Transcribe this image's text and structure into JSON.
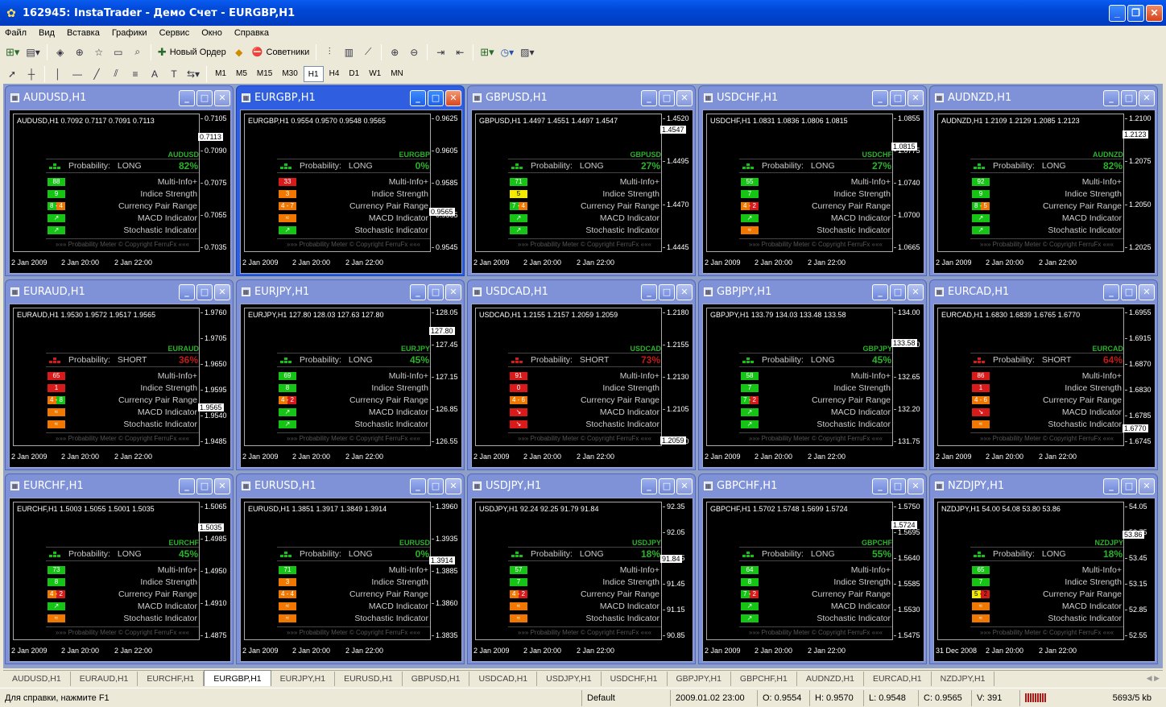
{
  "window": {
    "title": "162945: InstaTrader - Демо Счет - EURGBP,H1"
  },
  "menu": [
    "Файл",
    "Вид",
    "Вставка",
    "Графики",
    "Сервис",
    "Окно",
    "Справка"
  ],
  "toolbar": {
    "new_order": "Новый Ордер",
    "experts": "Советники"
  },
  "timeframes": [
    "M1",
    "M5",
    "M15",
    "M30",
    "H1",
    "H4",
    "D1",
    "W1",
    "MN"
  ],
  "active_timeframe": "H1",
  "panel": {
    "probability_label": "Probability:",
    "indicators": [
      "Multi-Info+",
      "Indice Strength",
      "Currency Pair Range",
      "MACD Indicator",
      "Stochastic Indicator"
    ],
    "copyright": "»»» Probability Meter © Copyright FerruFx «««"
  },
  "colors": {
    "green": "#16c416",
    "red": "#d81a1a",
    "orange": "#f07800",
    "yellow": "#f2ea00",
    "up_text": "#2bb32b",
    "down_text": "#c31a1a"
  },
  "charts": [
    {
      "title": "AUDUSD,H1",
      "ohlc": "AUDUSD,H1  0.7092 0.7117 0.7091 0.7113",
      "symbol": "AUDUSD",
      "dir": "LONG",
      "pct": "82%",
      "color": "green",
      "ind": [
        {
          "t": "88",
          "c": "green"
        },
        {
          "t": "9",
          "c": "green"
        },
        {
          "t": "8 - 4",
          "c": "green",
          "c2": "orange"
        },
        {
          "t": "↗",
          "c": "green"
        },
        {
          "t": "↗",
          "c": "green"
        }
      ],
      "prices": [
        "0.7105",
        "0.7090",
        "0.7075",
        "0.7055",
        "0.7035"
      ],
      "current": "0.7113",
      "cur_y": 0.17,
      "times": [
        "2 Jan 2009",
        "2 Jan 20:00",
        "2 Jan 22:00"
      ]
    },
    {
      "title": "EURGBP,H1",
      "ohlc": "EURGBP,H1  0.9554 0.9570 0.9548 0.9565",
      "symbol": "EURGBP",
      "dir": "LONG",
      "pct": "0%",
      "color": "green",
      "ind": [
        {
          "t": "33",
          "c": "red"
        },
        {
          "t": "3",
          "c": "orange"
        },
        {
          "t": "4 - 7",
          "c": "orange",
          "c2": "orange"
        },
        {
          "t": "≈",
          "c": "orange"
        },
        {
          "t": "↗",
          "c": "green"
        }
      ],
      "prices": [
        "0.9625",
        "0.9605",
        "0.9585",
        "0.9565",
        "0.9545"
      ],
      "current": "0.9565",
      "cur_y": 0.72,
      "times": [
        "2 Jan 2009",
        "2 Jan 20:00",
        "2 Jan 22:00"
      ]
    },
    {
      "title": "GBPUSD,H1",
      "ohlc": "GBPUSD,H1  1.4497 1.4551 1.4497 1.4547",
      "symbol": "GBPUSD",
      "dir": "LONG",
      "pct": "27%",
      "color": "green",
      "ind": [
        {
          "t": "71",
          "c": "green"
        },
        {
          "t": "5",
          "c": "yellow"
        },
        {
          "t": "7 - 4",
          "c": "green",
          "c2": "orange"
        },
        {
          "t": "↗",
          "c": "green"
        },
        {
          "t": "↗",
          "c": "green"
        }
      ],
      "prices": [
        "1.4520",
        "1.4495",
        "1.4470",
        "1.4445"
      ],
      "current": "1.4547",
      "cur_y": 0.12,
      "times": [
        "2 Jan 2009",
        "2 Jan 20:00",
        "2 Jan 22:00"
      ]
    },
    {
      "title": "USDCHF,H1",
      "ohlc": "USDCHF,H1  1.0831 1.0836 1.0806 1.0815",
      "symbol": "USDCHF",
      "dir": "LONG",
      "pct": "27%",
      "color": "green",
      "ind": [
        {
          "t": "55",
          "c": "green"
        },
        {
          "t": "7",
          "c": "green"
        },
        {
          "t": "4 - 2",
          "c": "orange",
          "c2": "red"
        },
        {
          "t": "↗",
          "c": "green"
        },
        {
          "t": "≈",
          "c": "orange"
        }
      ],
      "prices": [
        "1.0855",
        "1.0775",
        "1.0740",
        "1.0700",
        "1.0665"
      ],
      "current": "1.0815",
      "cur_y": 0.24,
      "times": [
        "2 Jan 2009",
        "2 Jan 20:00",
        "2 Jan 22:00"
      ]
    },
    {
      "title": "AUDNZD,H1",
      "ohlc": "AUDNZD,H1  1.2109 1.2129 1.2085 1.2123",
      "symbol": "AUDNZD",
      "dir": "LONG",
      "pct": "82%",
      "color": "green",
      "ind": [
        {
          "t": "92",
          "c": "green"
        },
        {
          "t": "9",
          "c": "green"
        },
        {
          "t": "8 - 5",
          "c": "green",
          "c2": "orange"
        },
        {
          "t": "↗",
          "c": "green"
        },
        {
          "t": "↗",
          "c": "green"
        }
      ],
      "prices": [
        "1.2100",
        "1.2075",
        "1.2050",
        "1.2025"
      ],
      "current": "1.2123",
      "cur_y": 0.15,
      "times": [
        "2 Jan 2009",
        "2 Jan 20:00",
        "2 Jan 22:00"
      ]
    },
    {
      "title": "EURAUD,H1",
      "ohlc": "EURAUD,H1  1.9530 1.9572 1.9517 1.9565",
      "symbol": "EURAUD",
      "dir": "SHORT",
      "pct": "36%",
      "color": "red",
      "ind": [
        {
          "t": "65",
          "c": "red"
        },
        {
          "t": "1",
          "c": "red"
        },
        {
          "t": "4 - 8",
          "c": "orange",
          "c2": "green"
        },
        {
          "t": "≈",
          "c": "orange"
        },
        {
          "t": "≈",
          "c": "orange"
        }
      ],
      "prices": [
        "1.9760",
        "1.9705",
        "1.9650",
        "1.9595",
        "1.9540",
        "1.9485"
      ],
      "current": "1.9565",
      "cur_y": 0.73,
      "times": [
        "2 Jan 2009",
        "2 Jan 20:00",
        "2 Jan 22:00"
      ]
    },
    {
      "title": "EURJPY,H1",
      "ohlc": "EURJPY,H1  127.80 128.03 127.63 127.80",
      "symbol": "EURJPY",
      "dir": "LONG",
      "pct": "45%",
      "color": "green",
      "ind": [
        {
          "t": "69",
          "c": "green"
        },
        {
          "t": "8",
          "c": "green"
        },
        {
          "t": "4 - 2",
          "c": "orange",
          "c2": "red"
        },
        {
          "t": "↗",
          "c": "green"
        },
        {
          "t": "↗",
          "c": "green"
        }
      ],
      "prices": [
        "128.05",
        "127.45",
        "127.15",
        "126.85",
        "126.55"
      ],
      "current": "127.80",
      "cur_y": 0.17,
      "times": [
        "2 Jan 2009",
        "2 Jan 20:00",
        "2 Jan 22:00"
      ]
    },
    {
      "title": "USDCAD,H1",
      "ohlc": "USDCAD,H1  1.2155 1.2157 1.2059 1.2059",
      "symbol": "USDCAD",
      "dir": "SHORT",
      "pct": "73%",
      "color": "red",
      "ind": [
        {
          "t": "91",
          "c": "red"
        },
        {
          "t": "0",
          "c": "red"
        },
        {
          "t": "4 - 6",
          "c": "orange",
          "c2": "orange"
        },
        {
          "t": "↘",
          "c": "red"
        },
        {
          "t": "↘",
          "c": "red"
        }
      ],
      "prices": [
        "1.2180",
        "1.2155",
        "1.2130",
        "1.2105",
        "1.2080"
      ],
      "current": "1.2059",
      "cur_y": 0.97,
      "times": [
        "2 Jan 2009",
        "2 Jan 20:00",
        "2 Jan 22:00"
      ]
    },
    {
      "title": "GBPJPY,H1",
      "ohlc": "GBPJPY,H1  133.79 134.03 133.48 133.58",
      "symbol": "GBPJPY",
      "dir": "LONG",
      "pct": "45%",
      "color": "green",
      "ind": [
        {
          "t": "58",
          "c": "green"
        },
        {
          "t": "7",
          "c": "green"
        },
        {
          "t": "7 - 2",
          "c": "green",
          "c2": "red"
        },
        {
          "t": "↗",
          "c": "green"
        },
        {
          "t": "↗",
          "c": "green"
        }
      ],
      "prices": [
        "134.00",
        "133.10",
        "132.65",
        "132.20",
        "131.75"
      ],
      "current": "133.58",
      "cur_y": 0.26,
      "times": [
        "2 Jan 2009",
        "2 Jan 20:00",
        "2 Jan 22:00"
      ]
    },
    {
      "title": "EURCAD,H1",
      "ohlc": "EURCAD,H1  1.6830 1.6839 1.6765 1.6770",
      "symbol": "EURCAD",
      "dir": "SHORT",
      "pct": "64%",
      "color": "red",
      "ind": [
        {
          "t": "86",
          "c": "red"
        },
        {
          "t": "1",
          "c": "red"
        },
        {
          "t": "4 - 6",
          "c": "orange",
          "c2": "orange"
        },
        {
          "t": "↘",
          "c": "red"
        },
        {
          "t": "≈",
          "c": "orange"
        }
      ],
      "prices": [
        "1.6955",
        "1.6915",
        "1.6870",
        "1.6830",
        "1.6785",
        "1.6745"
      ],
      "current": "1.6770",
      "cur_y": 0.88,
      "times": [
        "2 Jan 2009",
        "2 Jan 20:00",
        "2 Jan 22:00"
      ]
    },
    {
      "title": "EURCHF,H1",
      "ohlc": "EURCHF,H1  1.5003 1.5055 1.5001 1.5035",
      "symbol": "EURCHF",
      "dir": "LONG",
      "pct": "45%",
      "color": "green",
      "ind": [
        {
          "t": "73",
          "c": "green"
        },
        {
          "t": "8",
          "c": "green"
        },
        {
          "t": "4 - 2",
          "c": "orange",
          "c2": "red"
        },
        {
          "t": "↗",
          "c": "green"
        },
        {
          "t": "≈",
          "c": "orange"
        }
      ],
      "prices": [
        "1.5065",
        "1.4985",
        "1.4950",
        "1.4910",
        "1.4875"
      ],
      "current": "1.5035",
      "cur_y": 0.19,
      "times": [
        "2 Jan 2009",
        "2 Jan 20:00",
        "2 Jan 22:00"
      ]
    },
    {
      "title": "EURUSD,H1",
      "ohlc": "EURUSD,H1  1.3851 1.3917 1.3849 1.3914",
      "symbol": "EURUSD",
      "dir": "LONG",
      "pct": "0%",
      "color": "green",
      "ind": [
        {
          "t": "71",
          "c": "green"
        },
        {
          "t": "3",
          "c": "orange"
        },
        {
          "t": "4 - 4",
          "c": "orange",
          "c2": "orange"
        },
        {
          "t": "≈",
          "c": "orange"
        },
        {
          "t": "≈",
          "c": "orange"
        }
      ],
      "prices": [
        "1.3960",
        "1.3935",
        "1.3885",
        "1.3860",
        "1.3835"
      ],
      "current": "1.3914",
      "cur_y": 0.43,
      "times": [
        "2 Jan 2009",
        "2 Jan 20:00",
        "2 Jan 22:00"
      ]
    },
    {
      "title": "USDJPY,H1",
      "ohlc": "USDJPY,H1  92.24 92.25 91.79 91.84",
      "symbol": "USDJPY",
      "dir": "LONG",
      "pct": "18%",
      "color": "green",
      "ind": [
        {
          "t": "57",
          "c": "green"
        },
        {
          "t": "7",
          "c": "green"
        },
        {
          "t": "4 - 2",
          "c": "orange",
          "c2": "red"
        },
        {
          "t": "≈",
          "c": "orange"
        },
        {
          "t": "≈",
          "c": "orange"
        }
      ],
      "prices": [
        "92.35",
        "92.05",
        "91.75",
        "91.45",
        "91.15",
        "90.85"
      ],
      "current": "91.84",
      "cur_y": 0.42,
      "times": [
        "2 Jan 2009",
        "2 Jan 20:00",
        "2 Jan 22:00"
      ]
    },
    {
      "title": "GBPCHF,H1",
      "ohlc": "GBPCHF,H1  1.5702 1.5748 1.5699 1.5724",
      "symbol": "GBPCHF",
      "dir": "LONG",
      "pct": "55%",
      "color": "green",
      "ind": [
        {
          "t": "64",
          "c": "green"
        },
        {
          "t": "8",
          "c": "green"
        },
        {
          "t": "7 - 2",
          "c": "green",
          "c2": "red"
        },
        {
          "t": "↗",
          "c": "green"
        },
        {
          "t": "↗",
          "c": "green"
        }
      ],
      "prices": [
        "1.5750",
        "1.5695",
        "1.5640",
        "1.5585",
        "1.5530",
        "1.5475"
      ],
      "current": "1.5724",
      "cur_y": 0.17,
      "times": [
        "2 Jan 2009",
        "2 Jan 20:00",
        "2 Jan 22:00"
      ]
    },
    {
      "title": "NZDJPY,H1",
      "ohlc": "NZDJPY,H1  54.00 54.08 53.80 53.86",
      "symbol": "NZDJPY",
      "dir": "LONG",
      "pct": "18%",
      "color": "green",
      "ind": [
        {
          "t": "65",
          "c": "green"
        },
        {
          "t": "7",
          "c": "green"
        },
        {
          "t": "5 - 2",
          "c": "yellow",
          "c2": "red"
        },
        {
          "t": "≈",
          "c": "orange"
        },
        {
          "t": "≈",
          "c": "orange"
        }
      ],
      "prices": [
        "54.05",
        "53.75",
        "53.45",
        "53.15",
        "52.85",
        "52.55"
      ],
      "current": "53.86",
      "cur_y": 0.24,
      "times": [
        "31 Dec 2008",
        "2 Jan 20:00",
        "2 Jan 22:00"
      ]
    }
  ],
  "tabs": [
    "AUDUSD,H1",
    "EURAUD,H1",
    "EURCHF,H1",
    "EURGBP,H1",
    "EURJPY,H1",
    "EURUSD,H1",
    "GBPUSD,H1",
    "USDCAD,H1",
    "USDJPY,H1",
    "USDCHF,H1",
    "GBPJPY,H1",
    "GBPCHF,H1",
    "AUDNZD,H1",
    "EURCAD,H1",
    "NZDJPY,H1"
  ],
  "active_tab": "EURGBP,H1",
  "status": {
    "help": "Для справки, нажмите F1",
    "profile": "Default",
    "datetime": "2009.01.02 23:00",
    "open": "O: 0.9554",
    "high": "H: 0.9570",
    "low": "L: 0.9548",
    "close": "C: 0.9565",
    "volume": "V: 391",
    "traffic": "5693/5 kb"
  }
}
